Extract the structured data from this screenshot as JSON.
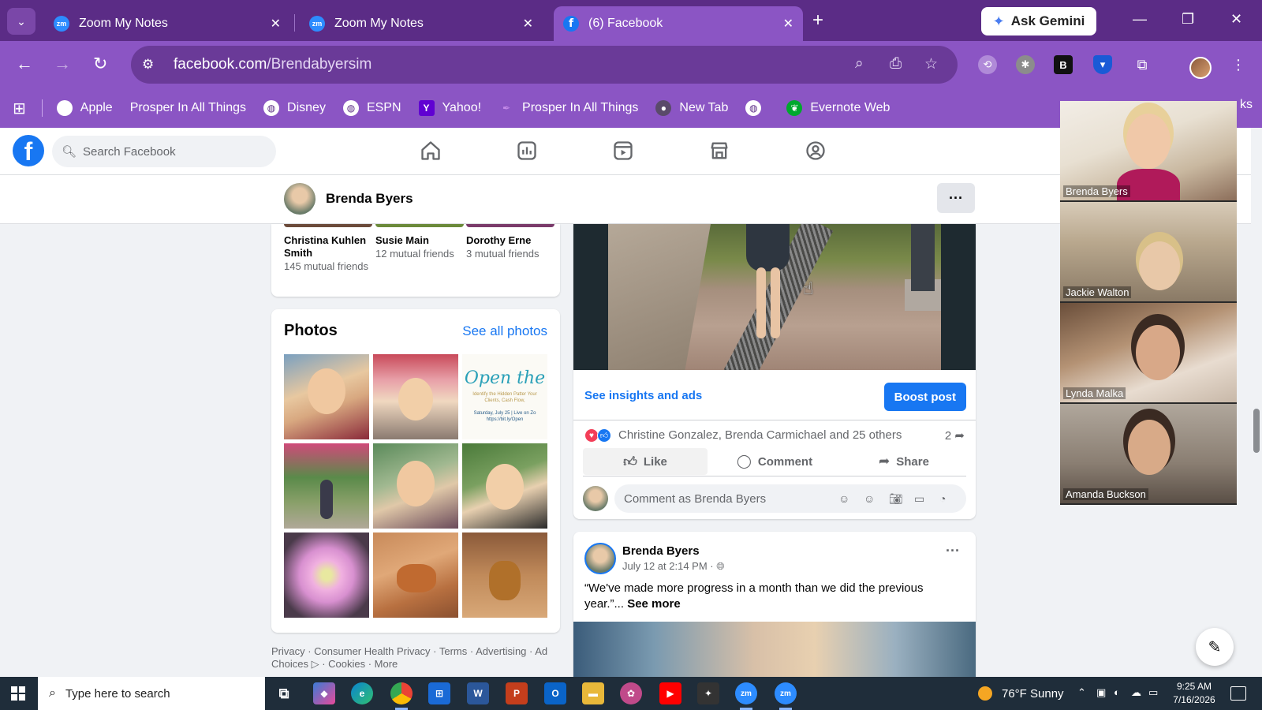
{
  "browser": {
    "tabs": [
      {
        "title": "Zoom My Notes",
        "favicon": "zm"
      },
      {
        "title": "Zoom My Notes",
        "favicon": "zm"
      },
      {
        "title": "(6) Facebook",
        "favicon": "f"
      }
    ],
    "ask_gemini": "Ask Gemini",
    "url_host": "facebook.com",
    "url_path": "/Brendabyersim",
    "bookmarks": [
      "Apple",
      "Prosper In All Things",
      "Disney",
      "ESPN",
      "Yahoo!",
      "Prosper In All Things",
      "New Tab",
      "",
      "Evernote Web"
    ],
    "bookmark_overflow": "ks",
    "accent_color": "#8b55c4"
  },
  "facebook": {
    "search_placeholder": "Search Facebook",
    "profile_name": "Brenda Byers",
    "friends": [
      {
        "name": "Christina Kuhlen Smith",
        "mutual": "145 mutual friends"
      },
      {
        "name": "Susie Main",
        "mutual": "12 mutual friends"
      },
      {
        "name": "Dorothy Erne",
        "mutual": "3 mutual friends"
      }
    ],
    "photos": {
      "title": "Photos",
      "see_all": "See all photos",
      "open_title": "Open the",
      "open_subtitle": "Identify the Hidden Patter Your Clients, Cash Flow,",
      "open_date": "Saturday, July 25 | Live on Zo https://bit.ly/Open"
    },
    "footer": "Privacy · Consumer Health Privacy · Terms · Advertising · Ad Choices ▷ · Cookies · More",
    "post1": {
      "insights": "See insights and ads",
      "boost": "Boost post",
      "reactions": "Christine Gonzalez, Brenda Carmichael and 25 others",
      "shares": "2",
      "like": "Like",
      "comment": "Comment",
      "share": "Share",
      "comment_placeholder": "Comment as Brenda Byers"
    },
    "post2": {
      "author": "Brenda Byers",
      "date": "July 12 at 2:14 PM · ",
      "text": "“We've made more progress in a month than we did the previous year.”... ",
      "see_more": "See more"
    }
  },
  "zoom": {
    "participants": [
      "Brenda Byers",
      "Jackie Walton",
      "Lynda Malka",
      "Amanda Buckson"
    ]
  },
  "taskbar": {
    "search_placeholder": "Type here to search",
    "weather": "76°F  Sunny",
    "time": "9:25 AM",
    "date": "7/16/2026"
  }
}
